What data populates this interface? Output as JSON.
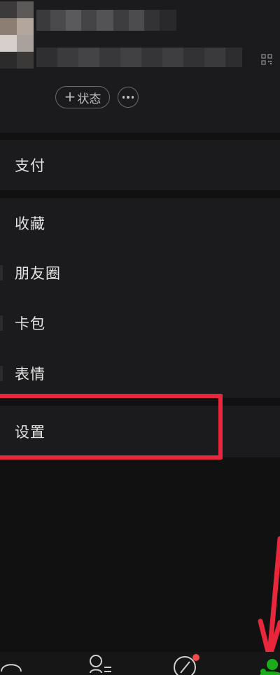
{
  "profile": {
    "status_label": "状态",
    "status_plus": "+"
  },
  "menu": {
    "pay": "支付",
    "favorites": "收藏",
    "moments": "朋友圈",
    "cards": "卡包",
    "stickers": "表情",
    "settings": "设置"
  },
  "colors": {
    "background": "#111111",
    "panel": "#1b1b1d",
    "highlight": "#e8263c",
    "accent_green": "#1aad19",
    "notify_red": "#f24a4a"
  },
  "tabbar": {
    "icons": [
      "chat-icon",
      "contacts-icon",
      "discover-icon",
      "me-icon"
    ]
  }
}
